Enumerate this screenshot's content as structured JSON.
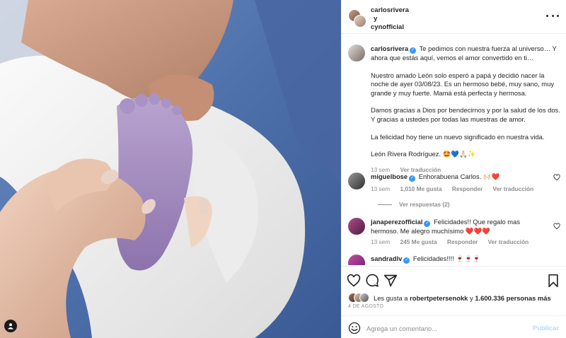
{
  "post": {
    "authors": [
      "carlosrivera",
      "y",
      "cynofficial"
    ],
    "caption": {
      "username": "carlosrivera",
      "lines": [
        "Te pedimos con nuestra fuerza al universo… Y ahora que estás aquí, vemos el amor convertido en ti…",
        "Nuestro amado León solo esperó a papá y decidió nacer la noche de ayer 03/08/23. Es un hermoso bebé, muy sano, muy grande y muy fuerte. Mamá está perfecta y hermosa.",
        "Damos gracias a Dios por bendecirnos y por la salud de los dos. Y gracias a ustedes por todas las muestras de amor.",
        "La felicidad hoy tiene un nuevo significado en nuestra vida.",
        "León Rivera Rodríguez. 🤩💙🙏🏻✨"
      ],
      "time": "13 sem",
      "translate": "Ver traducción"
    }
  },
  "comments": [
    {
      "username": "miguelbose",
      "verified": true,
      "text": "Enhorabuena Carlos. 🙌🏻❤️",
      "time": "13 sem",
      "likes": "1,010 Me gusta",
      "reply": "Responder",
      "translate": "Ver traducción",
      "view_replies": "Ver respuestas (2)"
    },
    {
      "username": "janaperezofficial",
      "verified": true,
      "text": "Felicidades!! Que regalo mas hermoso. Me alegro muchísimo ❤️❤️❤️",
      "time": "13 sem",
      "likes": "245 Me gusta",
      "reply": "Responder",
      "translate": "Ver traducción"
    },
    {
      "username": "sandradlv",
      "verified": true,
      "text": "Felicidades!!!! 🍷🍷🍷"
    }
  ],
  "likes": {
    "prefix": "Les gusta a ",
    "user": "robertpetersenokk",
    "middle": " y ",
    "count": "1.600.336 personas más"
  },
  "date": "4 DE AGOSTO",
  "add_comment": {
    "placeholder": "Agrega un comentario...",
    "publish": "Publicar"
  },
  "icons": {
    "like": "heart-icon",
    "comment": "comment-icon",
    "share": "share-icon",
    "save": "bookmark-icon",
    "emoji": "emoji-icon",
    "tags": "user-tag-icon"
  },
  "colors": {
    "verified": "#3897f0",
    "publish": "#b3dbff",
    "muted": "#8e8e8e"
  }
}
